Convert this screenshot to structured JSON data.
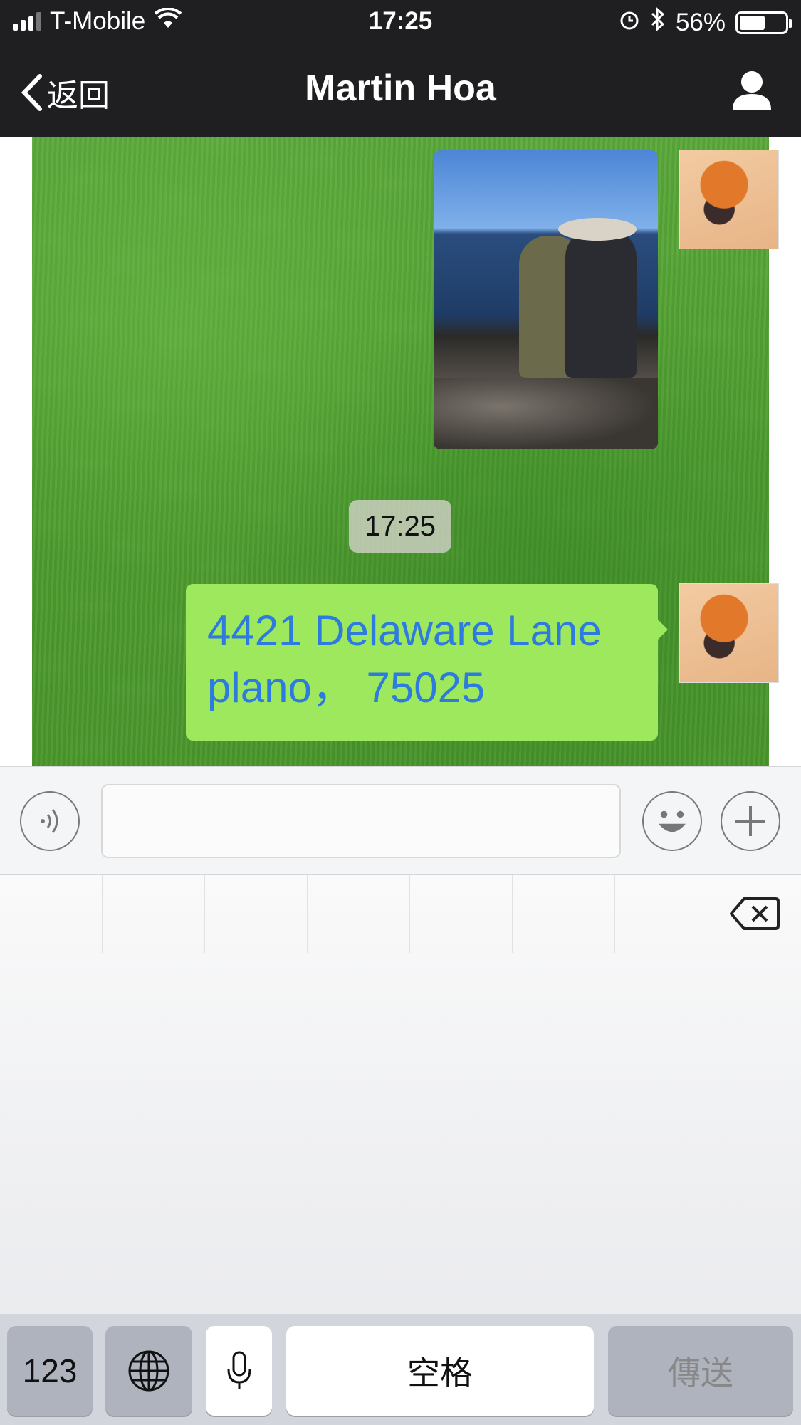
{
  "status_bar": {
    "carrier": "T-Mobile",
    "time": "17:25",
    "battery_percent": "56%",
    "battery_level": 0.56
  },
  "nav": {
    "back_label": "返回",
    "title": "Martin Hoa"
  },
  "chat": {
    "timestamp": "17:25",
    "address_line1": "4421 Delaware Lane",
    "address_line2": "plano， 75025"
  },
  "keyboard": {
    "numbers_label": "123",
    "space_label": "空格",
    "send_label": "傳送"
  },
  "colors": {
    "nav_background": "#1f1f21",
    "bubble_green": "#9ee85d",
    "link_blue": "#2e7be0"
  }
}
